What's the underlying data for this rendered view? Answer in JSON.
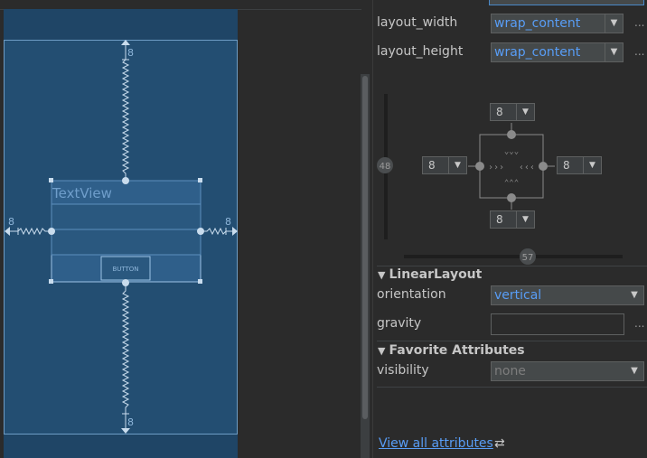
{
  "canvas": {
    "textview_label": "TextView",
    "button_label": "BUTTON",
    "margin_top": "8",
    "margin_bottom": "8",
    "margin_left": "8",
    "margin_right": "8"
  },
  "attributes": {
    "layout_width": {
      "label": "layout_width",
      "value": "wrap_content"
    },
    "layout_height": {
      "label": "layout_height",
      "value": "wrap_content"
    },
    "ellipsis": "..."
  },
  "constraint_widget": {
    "top_margin": "8",
    "bottom_margin": "8",
    "left_margin": "8",
    "right_margin": "8",
    "vertical_bias": "48",
    "horizontal_bias": "57"
  },
  "linear_layout": {
    "title": "LinearLayout",
    "orientation": {
      "label": "orientation",
      "value": "vertical"
    },
    "gravity": {
      "label": "gravity",
      "value": ""
    }
  },
  "favorite_attributes": {
    "title": "Favorite Attributes",
    "visibility": {
      "label": "visibility",
      "value": "none"
    }
  },
  "footer": {
    "view_all_label": "View all attributes"
  },
  "colors": {
    "accent": "#589df6",
    "blueprint": "#234e72",
    "panel_bg": "#2b2b2b"
  }
}
